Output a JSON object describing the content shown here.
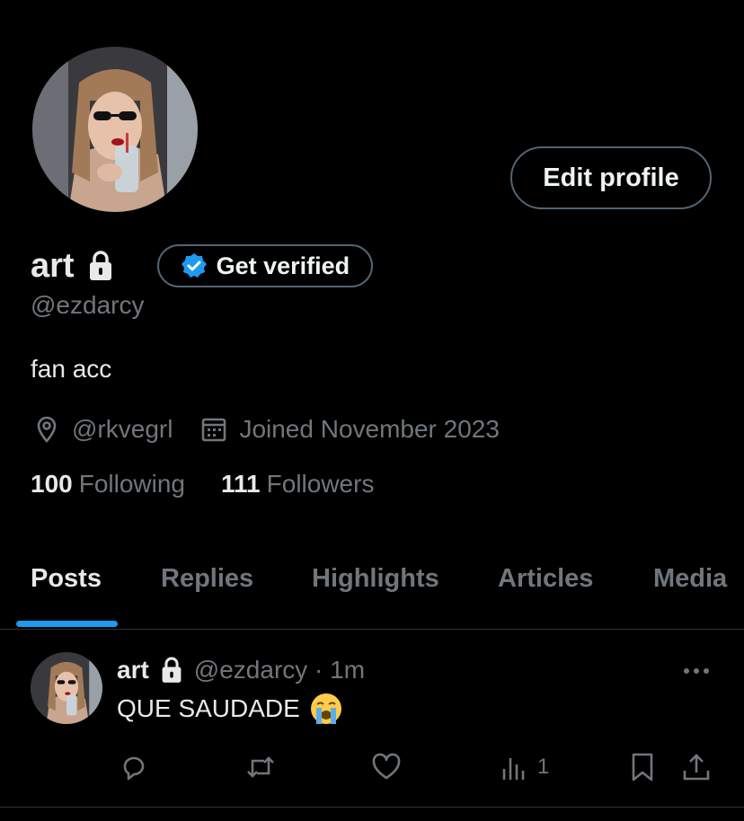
{
  "profile": {
    "name": "art",
    "handle": "@ezdarcy",
    "bio": "fan acc",
    "location": "@rkvegrl",
    "joined": "Joined November 2023",
    "following_count": "100",
    "following_label": "Following",
    "followers_count": "111",
    "followers_label": "Followers"
  },
  "buttons": {
    "edit_profile": "Edit profile",
    "get_verified": "Get verified"
  },
  "tabs": [
    "Posts",
    "Replies",
    "Highlights",
    "Articles",
    "Media"
  ],
  "post": {
    "name": "art",
    "handle_time": "@ezdarcy · 1m",
    "text": "QUE SAUDADE",
    "views": "1"
  },
  "colors": {
    "background": "#000000",
    "accent": "#1d9bf0",
    "muted": "#71767b",
    "text": "#e7e9ea"
  }
}
